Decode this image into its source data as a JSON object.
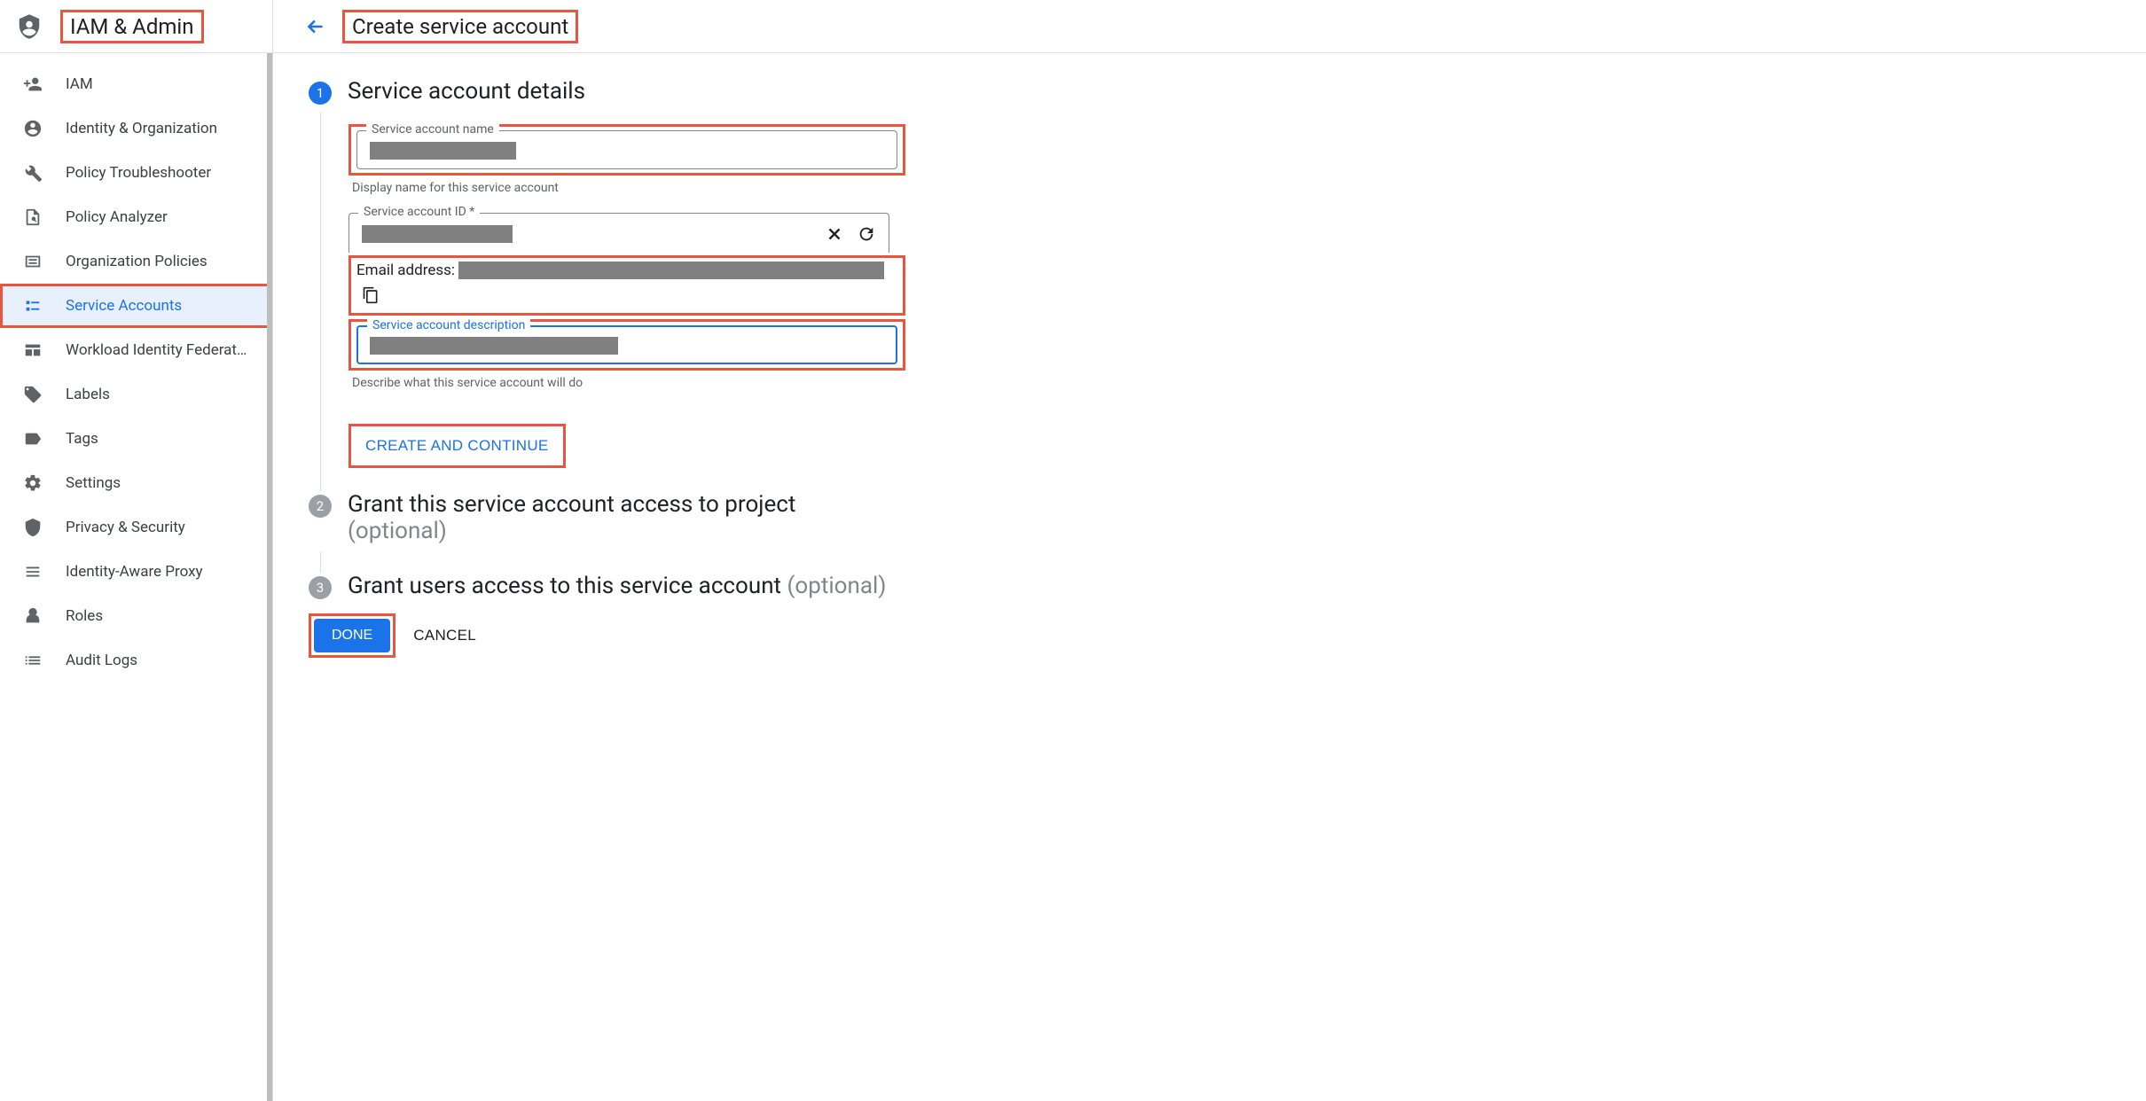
{
  "sidebar": {
    "title": "IAM & Admin",
    "items": [
      {
        "label": "IAM",
        "icon": "person-add-icon",
        "active": false
      },
      {
        "label": "Identity & Organization",
        "icon": "person-circle-icon",
        "active": false
      },
      {
        "label": "Policy Troubleshooter",
        "icon": "wrench-icon",
        "active": false
      },
      {
        "label": "Policy Analyzer",
        "icon": "policy-analyzer-icon",
        "active": false
      },
      {
        "label": "Organization Policies",
        "icon": "list-box-icon",
        "active": false
      },
      {
        "label": "Service Accounts",
        "icon": "service-account-icon",
        "active": true
      },
      {
        "label": "Workload Identity Federat…",
        "icon": "workload-icon",
        "active": false
      },
      {
        "label": "Labels",
        "icon": "tag-icon",
        "active": false
      },
      {
        "label": "Tags",
        "icon": "tags-icon",
        "active": false
      },
      {
        "label": "Settings",
        "icon": "gear-icon",
        "active": false
      },
      {
        "label": "Privacy & Security",
        "icon": "shield-icon",
        "active": false
      },
      {
        "label": "Identity-Aware Proxy",
        "icon": "iap-icon",
        "active": false
      },
      {
        "label": "Roles",
        "icon": "roles-icon",
        "active": false
      },
      {
        "label": "Audit Logs",
        "icon": "audit-logs-icon",
        "active": false
      }
    ]
  },
  "header": {
    "page_title": "Create service account"
  },
  "steps": {
    "one": {
      "number": "1",
      "title": "Service account details",
      "name_field": {
        "label": "Service account name",
        "helper": "Display name for this service account"
      },
      "id_field": {
        "label": "Service account ID *"
      },
      "email_label": "Email address:",
      "desc_field": {
        "label": "Service account description",
        "helper": "Describe what this service account will do"
      },
      "create_button": "CREATE AND CONTINUE"
    },
    "two": {
      "number": "2",
      "title": "Grant this service account access to project",
      "optional": "(optional)"
    },
    "three": {
      "number": "3",
      "title": "Grant users access to this service account ",
      "optional": "(optional)"
    }
  },
  "actions": {
    "done": "DONE",
    "cancel": "CANCEL"
  }
}
